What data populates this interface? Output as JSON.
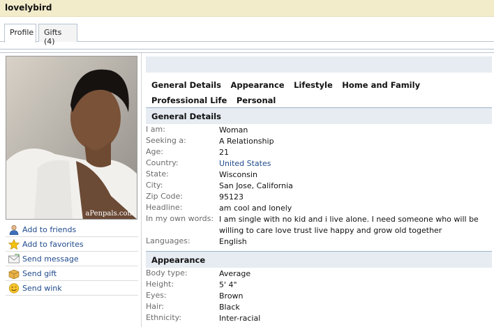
{
  "profile": {
    "username": "lovelybird"
  },
  "tabs": [
    {
      "label": "Profile",
      "active": true
    },
    {
      "label": "Gifts (4)",
      "active": false
    }
  ],
  "photo": {
    "watermark": "aPenpals.com"
  },
  "actions": [
    {
      "label": "Add to friends",
      "icon": "person-icon"
    },
    {
      "label": "Add to favorites",
      "icon": "star-icon"
    },
    {
      "label": "Send message",
      "icon": "envelope-icon"
    },
    {
      "label": "Send gift",
      "icon": "gift-box-icon"
    },
    {
      "label": "Send wink",
      "icon": "smiley-icon"
    }
  ],
  "section_nav": [
    "General Details",
    "Appearance",
    "Lifestyle",
    "Home and Family",
    "Professional Life",
    "Personal"
  ],
  "general": {
    "title": "General Details",
    "rows": [
      {
        "label": "I am:",
        "value": "Woman"
      },
      {
        "label": "Seeking a:",
        "value": "A Relationship"
      },
      {
        "label": "Age:",
        "value": "21"
      },
      {
        "label": "Country:",
        "value": "United States"
      },
      {
        "label": "State:",
        "value": "Wisconsin"
      },
      {
        "label": "City:",
        "value": "San Jose, California"
      },
      {
        "label": "Zip Code:",
        "value": "95123"
      },
      {
        "label": "Headline:",
        "value": "am cool and lonely"
      },
      {
        "label": "In my own words:",
        "value": "I am single with no kid and i live alone. I need someone who will be willing to care love trust live happy and grow old together"
      },
      {
        "label": "Languages:",
        "value": "English"
      }
    ]
  },
  "appearance": {
    "title": "Appearance",
    "rows": [
      {
        "label": "Body type:",
        "value": "Average"
      },
      {
        "label": "Height:",
        "value": "5' 4\""
      },
      {
        "label": "Eyes:",
        "value": "Brown"
      },
      {
        "label": "Hair:",
        "value": "Black"
      },
      {
        "label": "Ethnicity:",
        "value": "Inter-racial"
      }
    ]
  },
  "colors": {
    "link": "#1f4a8c",
    "header_bg": "#f3eccb",
    "section_bg": "#e6ecf2"
  }
}
